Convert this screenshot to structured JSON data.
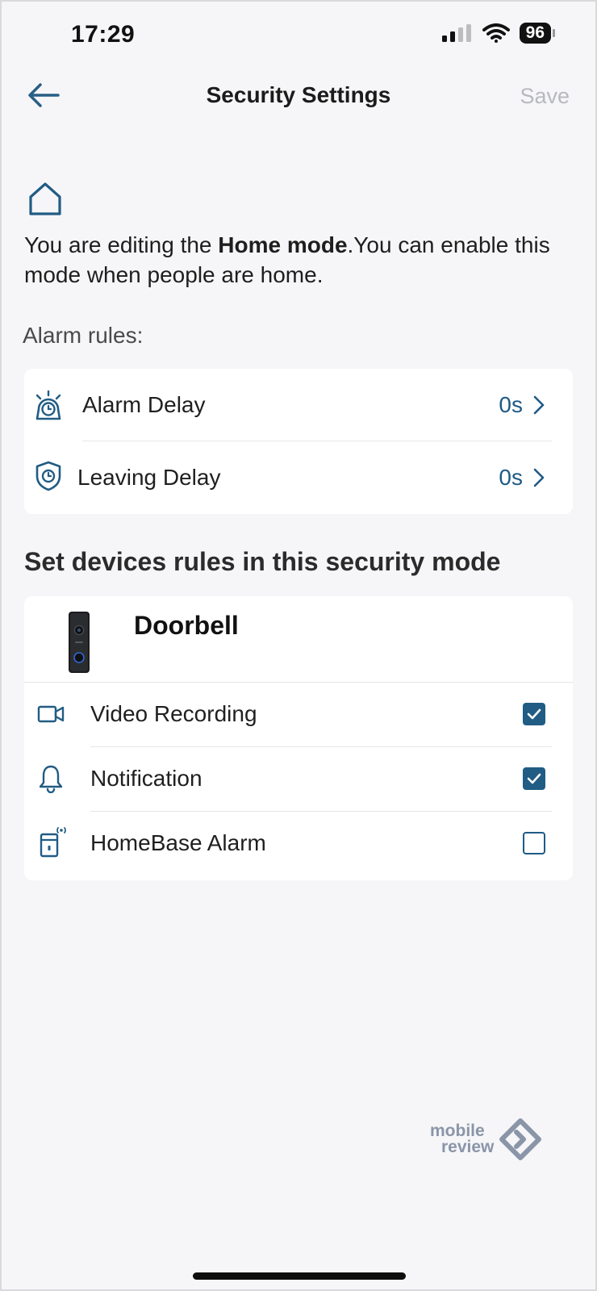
{
  "status_bar": {
    "time": "17:29",
    "battery": "96"
  },
  "nav": {
    "title": "Security Settings",
    "save_label": "Save"
  },
  "intro": {
    "prefix": "You are editing the ",
    "mode": "Home mode",
    "suffix": ".You can enable this mode when people are home."
  },
  "alarm_rules": {
    "label": "Alarm rules:",
    "items": [
      {
        "label": "Alarm Delay",
        "value": "0s",
        "icon": "alarm-clock-icon"
      },
      {
        "label": "Leaving Delay",
        "value": "0s",
        "icon": "shield-clock-icon"
      }
    ]
  },
  "devices": {
    "heading": "Set devices rules in this security mode",
    "device_name": "Doorbell",
    "rules": [
      {
        "label": "Video Recording",
        "checked": true,
        "icon": "video-camera-icon"
      },
      {
        "label": "Notification",
        "checked": true,
        "icon": "bell-icon"
      },
      {
        "label": "HomeBase Alarm",
        "checked": false,
        "icon": "homebase-alarm-icon"
      }
    ]
  },
  "watermark": {
    "line1": "mobile",
    "line2": "review"
  },
  "colors": {
    "accent": "#215c84",
    "background": "#f6f6f8",
    "save_disabled": "#b7b9bd"
  }
}
